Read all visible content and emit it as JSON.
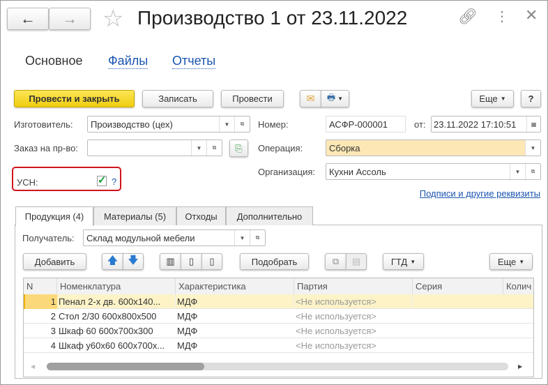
{
  "header": {
    "title": "Производство 1 от 23.11.2022",
    "back": "←",
    "forward": "→"
  },
  "nav": {
    "tabs": [
      {
        "label": "Основное"
      },
      {
        "label": "Файлы"
      },
      {
        "label": "Отчеты"
      }
    ]
  },
  "toolbar": {
    "post_close": "Провести и закрыть",
    "save": "Записать",
    "post": "Провести",
    "more": "Еще",
    "help": "?"
  },
  "form": {
    "maker_label": "Изготовитель:",
    "maker_value": "Производство (цех)",
    "number_label": "Номер:",
    "number_value": "АСФР-000001",
    "date_label": "от:",
    "date_value": "23.11.2022 17:10:51",
    "order_label": "Заказ на пр-во:",
    "order_value": "",
    "operation_label": "Операция:",
    "operation_value": "Сборка",
    "usn_label": "УСН:",
    "usn_checked": true,
    "usn_help": "?",
    "org_label": "Организация:",
    "org_value": "Кухни Ассоль",
    "signatures_link": "Подписи и другие реквизиты"
  },
  "colors": {
    "primary_button": "#f5d92a",
    "highlight": "#fde8b5",
    "selected_row": "#fdf3c7",
    "usn_border": "#d0141c",
    "link": "#1a55b0"
  },
  "panel": {
    "tabs": [
      {
        "label": "Продукция (4)",
        "active": true
      },
      {
        "label": "Материалы (5)"
      },
      {
        "label": "Отходы"
      },
      {
        "label": "Дополнительно"
      }
    ],
    "recipient_label": "Получатель:",
    "recipient_value": "Склад модульной мебели",
    "add": "Добавить",
    "pick": "Подобрать",
    "gtd": "ГТД",
    "more": "Еще",
    "table": {
      "columns": [
        "N",
        "Номенклатура",
        "Характеристика",
        "Партия",
        "Серия",
        "Колич"
      ],
      "rows": [
        [
          "1",
          "Пенал 2-х дв. 600х140...",
          "МДФ",
          "<Не используется>"
        ],
        [
          "2",
          "Стол 2/30 600х800х500",
          "МДФ",
          "<Не используется>"
        ],
        [
          "3",
          "Шкаф 60 600х700х300",
          "МДФ",
          "<Не используется>"
        ],
        [
          "4",
          "Шкаф у60х60 600х700х...",
          "МДФ",
          "<Не используется>"
        ]
      ]
    }
  }
}
